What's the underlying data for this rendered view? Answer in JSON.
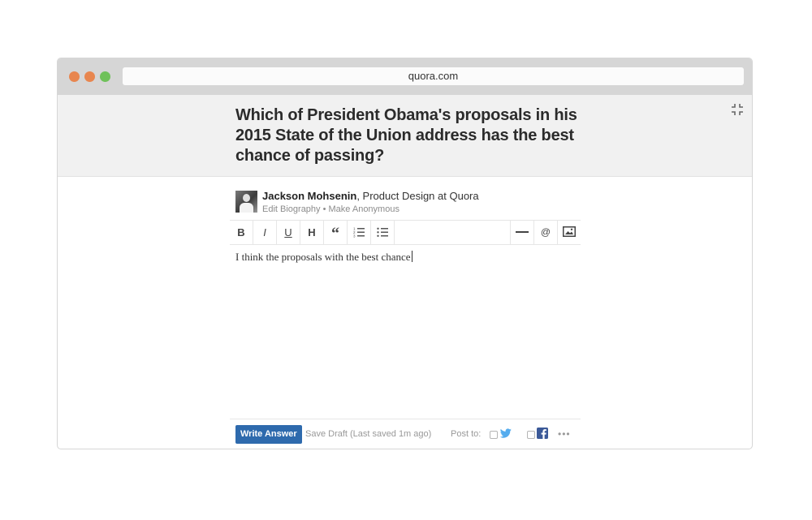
{
  "browser": {
    "url": "quora.com"
  },
  "question": {
    "title": "Which of President Obama's proposals in his 2015 State of the Union address has the best chance of passing?"
  },
  "author": {
    "name": "Jackson Mohsenin",
    "credential": ", Product Design at Quora",
    "edit_bio": "Edit Biography",
    "separator": " • ",
    "make_anonymous": "Make Anonymous"
  },
  "toolbar": {
    "bold": "B",
    "italic": "I",
    "underline": "U",
    "heading": "H",
    "quote": "“",
    "mention": "@"
  },
  "editor": {
    "text": "I think the proposals with the best chance"
  },
  "footer": {
    "write_answer": "Write Answer",
    "save_draft": "Save Draft (Last saved 1m ago)",
    "post_to": "Post to:",
    "more": "•••"
  },
  "colors": {
    "primary_button": "#2e6aad",
    "twitter": "#55acee",
    "facebook": "#3b5998",
    "traffic_close": "#e8864f",
    "traffic_max": "#6fc15a"
  },
  "icons": [
    "collapse-icon",
    "ordered-list-icon",
    "bullet-list-icon",
    "horizontal-rule-icon",
    "image-icon",
    "twitter-icon",
    "facebook-icon",
    "more-icon"
  ]
}
